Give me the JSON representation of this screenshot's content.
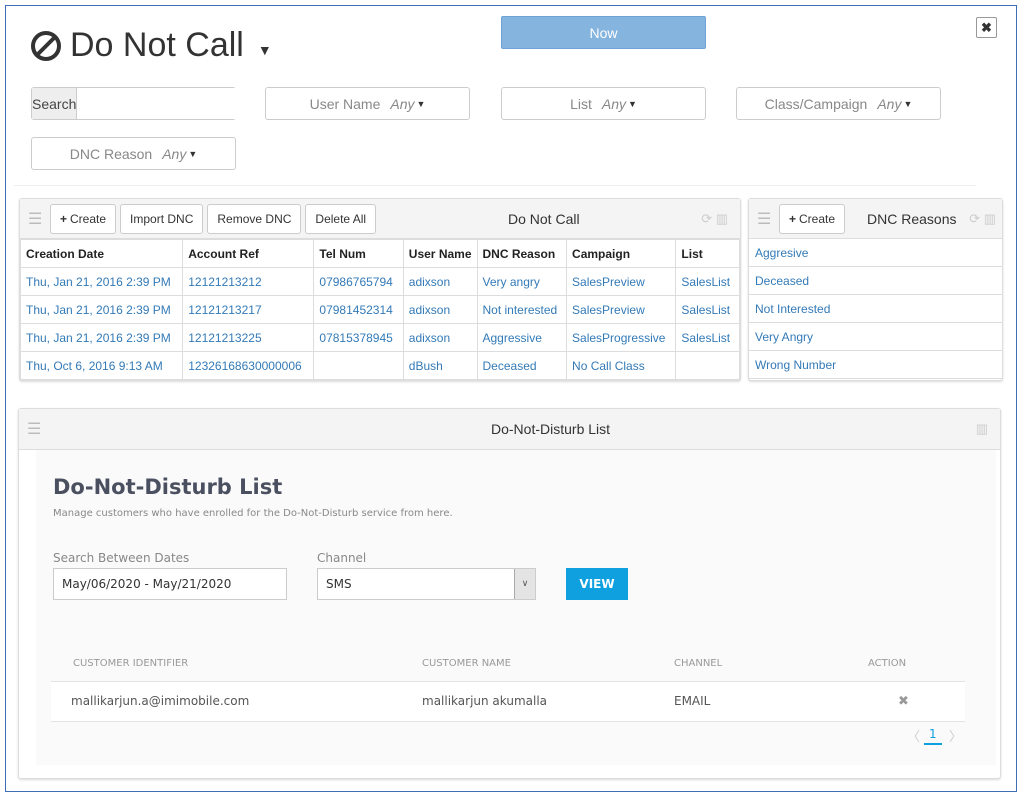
{
  "header": {
    "title": "Do Not Call",
    "title_icon": "ban-icon",
    "now_label": "Now",
    "close_icon": "close-icon"
  },
  "filters": {
    "search_label": "Search",
    "search_value": "",
    "user_name": {
      "label": "User Name",
      "value": "Any"
    },
    "list": {
      "label": "List",
      "value": "Any"
    },
    "class_campaign": {
      "label": "Class/Campaign",
      "value": "Any"
    },
    "dnc_reason": {
      "label": "DNC Reason",
      "value": "Any"
    }
  },
  "dnc_panel": {
    "title": "Do Not Call",
    "buttons": {
      "create": "Create",
      "import": "Import DNC",
      "remove": "Remove DNC",
      "delete_all": "Delete All"
    },
    "columns": [
      "Creation Date",
      "Account Ref",
      "Tel Num",
      "User Name",
      "DNC Reason",
      "Campaign",
      "List"
    ],
    "rows": [
      [
        "Thu, Jan 21, 2016 2:39 PM",
        "12121213212",
        "07986765794",
        "adixson",
        "Very angry",
        "SalesPreview",
        "SalesList"
      ],
      [
        "Thu, Jan 21, 2016 2:39 PM",
        "12121213217",
        "07981452314",
        "adixson",
        "Not interested",
        "SalesPreview",
        "SalesList"
      ],
      [
        "Thu, Jan 21, 2016 2:39 PM",
        "12121213225",
        "07815378945",
        "adixson",
        "Aggressive",
        "SalesProgressive",
        "SalesList"
      ],
      [
        "Thu, Oct 6, 2016 9:13 AM",
        "12326168630000006",
        "",
        "dBush",
        "Deceased",
        "No Call Class",
        ""
      ]
    ]
  },
  "reasons_panel": {
    "title": "DNC Reasons",
    "create": "Create",
    "items": [
      "Aggresive",
      "Deceased",
      "Not Interested",
      "Very Angry",
      "Wrong Number"
    ]
  },
  "dnd_panel": {
    "header_title": "Do-Not-Disturb List",
    "title": "Do-Not-Disturb List",
    "subtitle": "Manage customers who have enrolled for the Do-Not-Disturb service from here.",
    "date_label": "Search Between Dates",
    "date_value": "May/06/2020 - May/21/2020",
    "channel_label": "Channel",
    "channel_value": "SMS",
    "view_label": "VIEW",
    "columns": [
      "CUSTOMER IDENTIFIER",
      "CUSTOMER NAME",
      "CHANNEL",
      "ACTION"
    ],
    "rows": [
      {
        "identifier": "mallikarjun.a@imimobile.com",
        "name": "mallikarjun akumalla",
        "channel": "EMAIL"
      }
    ],
    "page": "1",
    "accent": "#0fa0e0"
  }
}
